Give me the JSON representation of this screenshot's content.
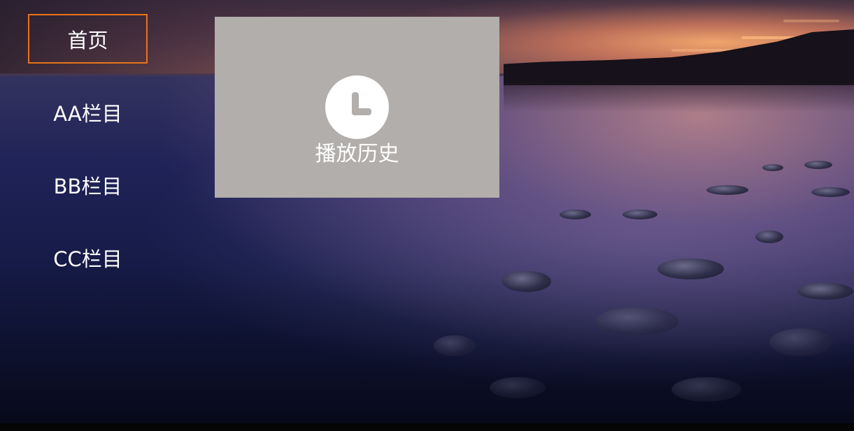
{
  "nav": {
    "items": [
      {
        "label": "首页",
        "focused": true
      },
      {
        "label": "AA栏目",
        "focused": false
      },
      {
        "label": "BB栏目",
        "focused": false
      },
      {
        "label": "CC栏目",
        "focused": false
      }
    ]
  },
  "content": {
    "history_tile": {
      "label": "播放历史",
      "icon": "clock-icon",
      "background_color": "#b2aeab"
    }
  },
  "colors": {
    "focus_border": "#e8741a",
    "text": "#ffffff"
  }
}
